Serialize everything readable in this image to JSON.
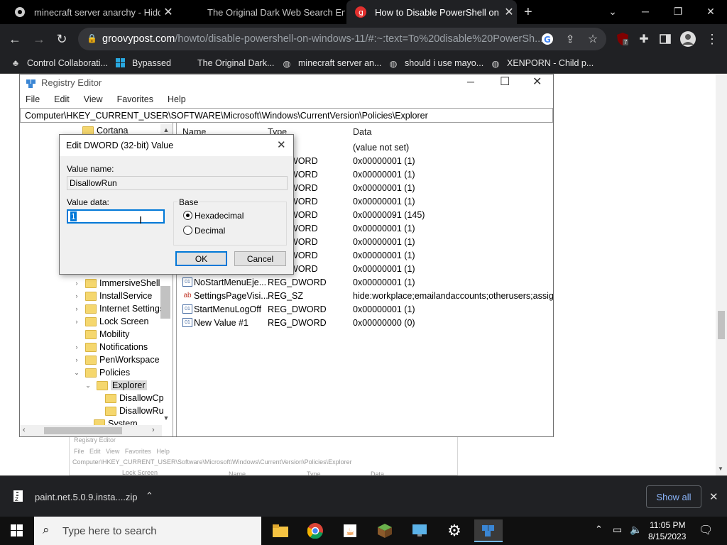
{
  "browser": {
    "tabs": [
      {
        "label": "minecraft server anarchy - Hidde",
        "active": false
      },
      {
        "label": "The Original Dark Web Search En",
        "active": false
      },
      {
        "label": "How to Disable PowerShell on W",
        "active": true
      }
    ],
    "new_tab": "+",
    "url_host": "groovypost.com",
    "url_path": "/howto/disable-powershell-on-windows-11/#:~:text=To%20disable%20PowerSh...",
    "extension_badge": "7",
    "bookmarks": [
      "Control Collaborati...",
      "Bypassed",
      "The Original Dark...",
      "minecraft server an...",
      "should i use mayo...",
      "XENPORN - Child p..."
    ]
  },
  "regedit": {
    "title": "Registry Editor",
    "menu": [
      "File",
      "Edit",
      "View",
      "Favorites",
      "Help"
    ],
    "path": "Computer\\HKEY_CURRENT_USER\\SOFTWARE\\Microsoft\\Windows\\CurrentVersion\\Policies\\Explorer",
    "tree": {
      "top": "Cortana",
      "items": [
        "ImmersiveShell",
        "InstallService",
        "Internet Settings",
        "Lock Screen",
        "Mobility",
        "Notifications",
        "PenWorkspace",
        "Policies",
        "Explorer",
        "DisallowCp",
        "DisallowRu",
        "System"
      ]
    },
    "columns": {
      "name": "Name",
      "type": "Type",
      "data": "Data"
    },
    "rows": [
      {
        "name": "",
        "type": "",
        "data": "(value not set)"
      },
      {
        "name": "",
        "type": "DWORD",
        "data": "0x00000001 (1)"
      },
      {
        "name": "",
        "type": "DWORD",
        "data": "0x00000001 (1)"
      },
      {
        "name": "",
        "type": "DWORD",
        "data": "0x00000001 (1)"
      },
      {
        "name": "",
        "type": "DWORD",
        "data": "0x00000001 (1)"
      },
      {
        "name": "",
        "type": "DWORD",
        "data": "0x00000091 (145)"
      },
      {
        "name": "",
        "type": "DWORD",
        "data": "0x00000001 (1)"
      },
      {
        "name": "",
        "type": "DWORD",
        "data": "0x00000001 (1)"
      },
      {
        "name": "",
        "type": "DWORD",
        "data": "0x00000001 (1)"
      },
      {
        "name": "",
        "type": "DWORD",
        "data": "0x00000001 (1)"
      },
      {
        "name": "NoStartMenuEje...",
        "type": "REG_DWORD",
        "data": "0x00000001 (1)"
      },
      {
        "name": "SettingsPageVisi...",
        "type": "REG_SZ",
        "data": "hide:workplace;emailandaccounts;otherusers;assig..."
      },
      {
        "name": "StartMenuLogOff",
        "type": "REG_DWORD",
        "data": "0x00000001 (1)"
      },
      {
        "name": "New Value #1",
        "type": "REG_DWORD",
        "data": "0x00000000 (0)"
      }
    ]
  },
  "dialog": {
    "title": "Edit DWORD (32-bit) Value",
    "value_name_label": "Value name:",
    "value_name": "DisallowRun",
    "value_data_label": "Value data:",
    "value_data": "1",
    "base_label": "Base",
    "hex_label": "Hexadecimal",
    "dec_label": "Decimal",
    "ok": "OK",
    "cancel": "Cancel"
  },
  "bg_screenshot": {
    "title": "Registry Editor",
    "menu": "File   Edit   View   Favorites   Help",
    "path": "Computer\\HKEY_CURRENT_USER\\Software\\Microsoft\\Windows\\CurrentVersion\\Policies\\Explorer",
    "tree_item": "Lock Screen",
    "cols": [
      "Name",
      "Type",
      "Data"
    ]
  },
  "download": {
    "file": "paint.net.5.0.9.insta....zip",
    "show_all": "Show all"
  },
  "taskbar": {
    "search_placeholder": "Type here to search",
    "time": "11:05 PM",
    "date": "8/15/2023"
  },
  "colors": {
    "accent": "#0078d7",
    "selection": "#0078d7",
    "chrome_bg": "#202124"
  }
}
